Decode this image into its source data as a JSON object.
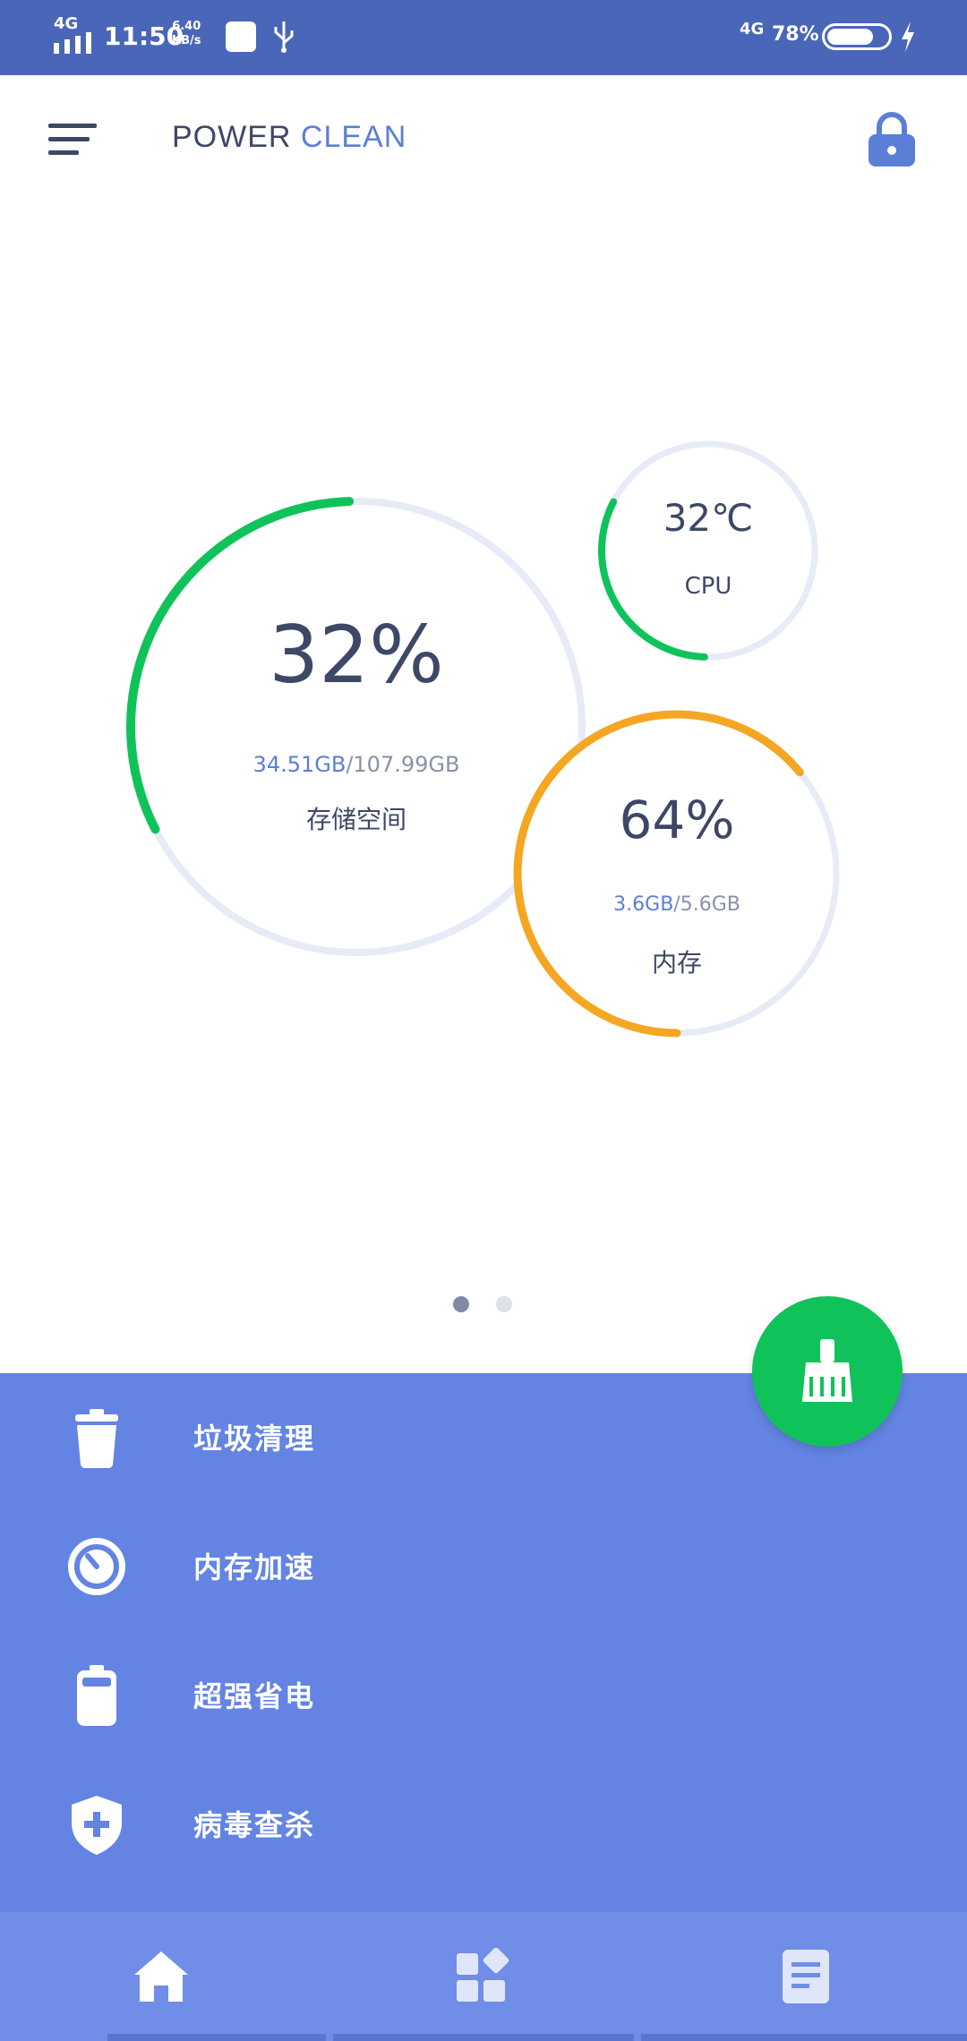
{
  "status_bar": {
    "network_left": "4G",
    "time": "11:50",
    "speed_value": "6.40",
    "speed_unit": "KB/s",
    "network_right": "4G",
    "battery_percent": "78%",
    "battery_level": 0.78
  },
  "app_bar": {
    "title_part1": "POWER",
    "title_part2": "CLEAN"
  },
  "gauges": {
    "storage": {
      "value": "32%",
      "detail_used": "34.51GB",
      "detail_total": "/107.99GB",
      "label": "存储空间",
      "fraction": 0.32
    },
    "cpu": {
      "value": "32℃",
      "label": "CPU",
      "fraction": 0.32
    },
    "memory": {
      "value": "64%",
      "detail_used": "3.6GB",
      "detail_total": "/5.6GB",
      "label": "内存",
      "fraction": 0.64
    }
  },
  "colors": {
    "status_bar": "#4a66b8",
    "panel": "#6384e3",
    "accent_green": "#0fc35a",
    "accent_orange": "#f5a623",
    "track": "#e6ebf7",
    "text_dark": "#3d4866",
    "text_blue": "#5b7fd6"
  },
  "menu": [
    {
      "icon": "trash-icon",
      "label": "垃圾清理"
    },
    {
      "icon": "speedometer-icon",
      "label": "内存加速"
    },
    {
      "icon": "battery-icon",
      "label": "超强省电"
    },
    {
      "icon": "shield-plus-icon",
      "label": "病毒查杀"
    }
  ],
  "fab": {
    "icon": "broom-icon"
  },
  "bottom_nav": [
    {
      "icon": "home-icon"
    },
    {
      "icon": "apps-icon"
    },
    {
      "icon": "document-icon"
    }
  ]
}
